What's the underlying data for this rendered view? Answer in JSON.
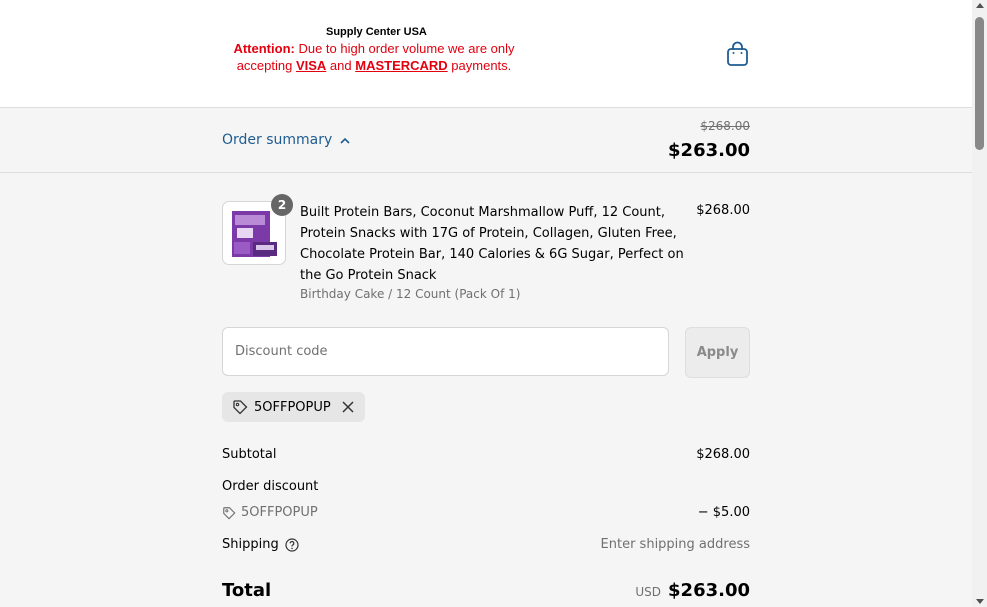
{
  "header": {
    "store_name": "Supply Center USA",
    "notice_attention": "Attention:",
    "notice_text_1": " Due to high order volume we are only accepting ",
    "notice_visa": "VISA",
    "notice_and": " and ",
    "notice_mastercard": "MASTERCARD",
    "notice_text_2": " payments.",
    "cart_icon": "shopping-bag-icon"
  },
  "summary_bar": {
    "toggle_label": "Order summary",
    "original_price": "$268.00",
    "total": "$263.00"
  },
  "product": {
    "quantity": "2",
    "title": "Built Protein Bars, Coconut Marshmallow Puff, 12 Count, Protein Snacks with 17G of Protein, Collagen, Gluten Free, Chocolate Protein Bar, 140 Calories & 6G Sugar, Perfect on the Go Protein Snack",
    "variant": "Birthday Cake / 12 Count (Pack Of 1)",
    "price": "$268.00"
  },
  "discount": {
    "placeholder": "Discount code",
    "apply_label": "Apply",
    "applied_code": "5OFFPOPUP"
  },
  "totals": {
    "subtotal_label": "Subtotal",
    "subtotal_value": "$268.00",
    "order_discount_label": "Order discount",
    "discount_code": "5OFFPOPUP",
    "discount_value": "− $5.00",
    "shipping_label": "Shipping",
    "shipping_value": "Enter shipping address",
    "total_label": "Total",
    "currency": "USD",
    "total_value": "$263.00"
  },
  "colors": {
    "link": "#1f5c92",
    "notice_red": "#e3000f",
    "muted": "#707070"
  }
}
